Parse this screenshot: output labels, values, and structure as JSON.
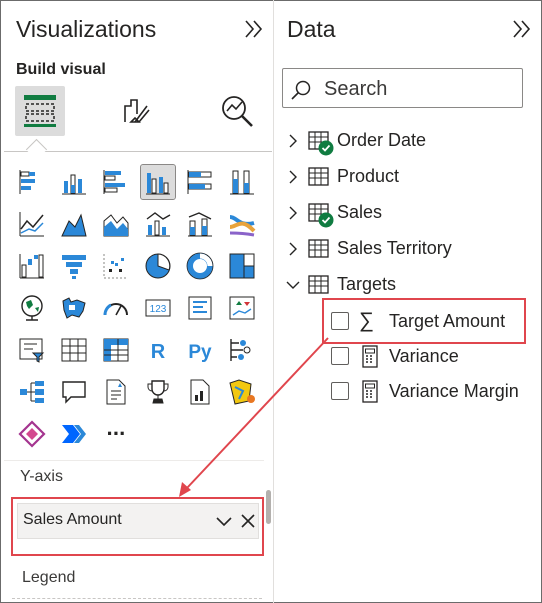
{
  "visualizations": {
    "title": "Visualizations",
    "build_label": "Build visual",
    "field_well": {
      "axis_label": "Y-axis",
      "field_value": "Sales Amount",
      "next_label": "Legend"
    },
    "more_glyph": "···"
  },
  "data_pane": {
    "title": "Data",
    "search_placeholder": "Search",
    "tree": [
      {
        "label": "Order Date"
      },
      {
        "label": "Product"
      },
      {
        "label": "Sales"
      },
      {
        "label": "Sales Territory"
      },
      {
        "label": "Targets"
      }
    ],
    "fields": [
      {
        "label": "Target Amount",
        "icon": "sigma-icon"
      },
      {
        "label": "Variance",
        "icon": "calculator-icon"
      },
      {
        "label": "Variance Margin",
        "icon": "calculator-icon"
      }
    ],
    "sigma_glyph": "∑"
  },
  "colors": {
    "accent_blue": "#2b88d8",
    "dark_blue": "#0f4c8a",
    "annotation_red": "#e0464d",
    "success_green": "#107c41"
  }
}
